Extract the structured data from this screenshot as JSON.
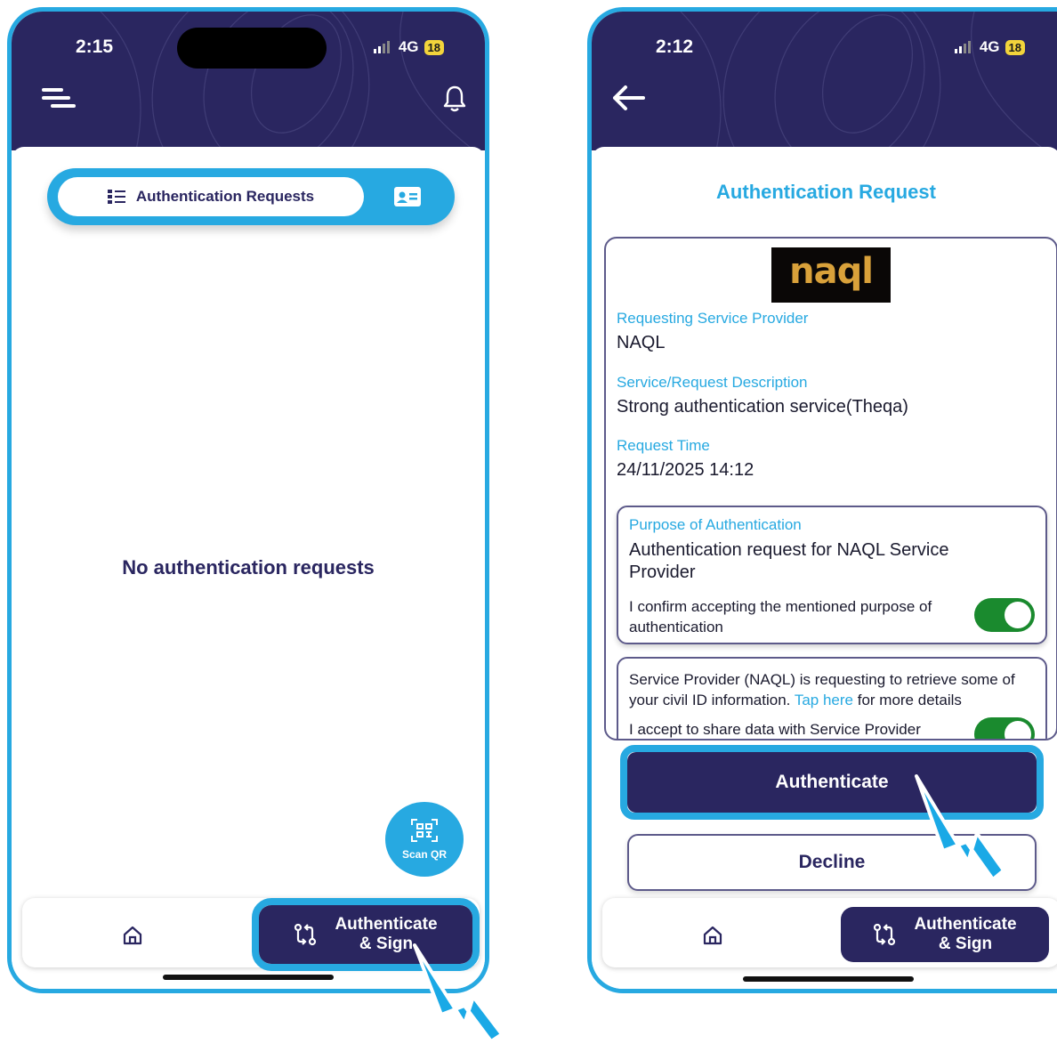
{
  "left_screen": {
    "status": {
      "time": "2:15",
      "network": "4G",
      "battery": "18"
    },
    "tabs": {
      "active_label": "Authentication Requests"
    },
    "empty_message": "No authentication requests",
    "scan_qr_label": "Scan QR",
    "nav": {
      "auth_line1": "Authenticate",
      "auth_line2": "& Sign"
    }
  },
  "right_screen": {
    "status": {
      "time": "2:12",
      "network": "4G",
      "battery": "18"
    },
    "title": "Authentication Request",
    "provider_logo_text": "naql",
    "fields": {
      "provider_label": "Requesting Service Provider",
      "provider_value": "NAQL",
      "description_label": "Service/Request Description",
      "description_value": "Strong authentication service(Theqa)",
      "time_label": "Request Time",
      "time_value": "24/11/2025 14:12"
    },
    "purpose": {
      "label": "Purpose of Authentication",
      "value": "Authentication request for NAQL Service Provider",
      "confirm_text": "I confirm accepting the mentioned purpose of authentication",
      "confirm_toggle_on": true
    },
    "civil_id": {
      "text_before": "Service Provider (NAQL) is requesting to retrieve some of your civil ID information.",
      "link_text": "Tap here",
      "text_after": "for more details",
      "cut_text": "I accept to share data with Service Provider",
      "toggle_on": true
    },
    "buttons": {
      "authenticate": "Authenticate",
      "decline": "Decline"
    },
    "nav": {
      "auth_line1": "Authenticate",
      "auth_line2": "& Sign"
    }
  },
  "colors": {
    "navy": "#2a2660",
    "accent_blue": "#27a9e1",
    "toggle_green": "#1a8a2e",
    "battery_yellow": "#f2d43b"
  },
  "icons": [
    "menu-icon",
    "bell-icon",
    "list-icon",
    "id-card-icon",
    "qr-scan-icon",
    "home-icon",
    "git-compare-icon",
    "back-arrow-icon",
    "pointer-cursor"
  ]
}
